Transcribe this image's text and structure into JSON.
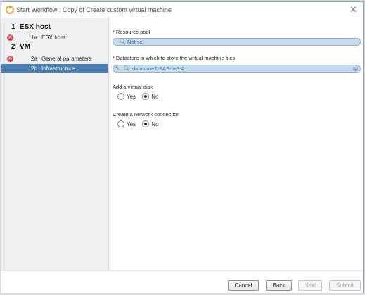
{
  "window": {
    "title": "Start Workflow : Copy of Create custom virtual machine",
    "close_label": "✕"
  },
  "sidebar": {
    "steps": [
      {
        "num": "1",
        "label": "ESX host",
        "level": "major",
        "error": false
      },
      {
        "num": "1a",
        "label": "ESX host",
        "level": "minor",
        "error": true
      },
      {
        "num": "2",
        "label": "VM",
        "level": "major",
        "error": false
      },
      {
        "num": "2a",
        "label": "General parameters",
        "level": "minor",
        "error": true
      },
      {
        "num": "2b",
        "label": "Infrastructure",
        "level": "minor",
        "error": false,
        "active": true
      }
    ],
    "error_glyph": "✕"
  },
  "form": {
    "resource_pool": {
      "required_mark": "*",
      "label": "Resource pool",
      "value": "Not set"
    },
    "datastore": {
      "required_mark": "*",
      "label": "Datastore in which to store the virtual machine files",
      "value": "datastore7-SAS-tw3-A"
    },
    "add_disk": {
      "label": "Add a virtual disk",
      "yes_label": "Yes",
      "no_label": "No",
      "selected": "No"
    },
    "network": {
      "label": "Create a network connection",
      "yes_label": "Yes",
      "no_label": "No",
      "selected": "No"
    }
  },
  "footer": {
    "cancel_label": "Cancel",
    "back_label": "Back",
    "next_label": "Next",
    "submit_label": "Submit"
  },
  "icons": {
    "logo": "vro-logo-icon",
    "search": "magnifier-icon",
    "edit": "edit-icon",
    "clear": "clear-icon"
  },
  "colors": {
    "accent": "#4a7eb5",
    "error": "#d63b3b",
    "picker_bg": "#c7dbef",
    "logo": "#f0a030"
  }
}
